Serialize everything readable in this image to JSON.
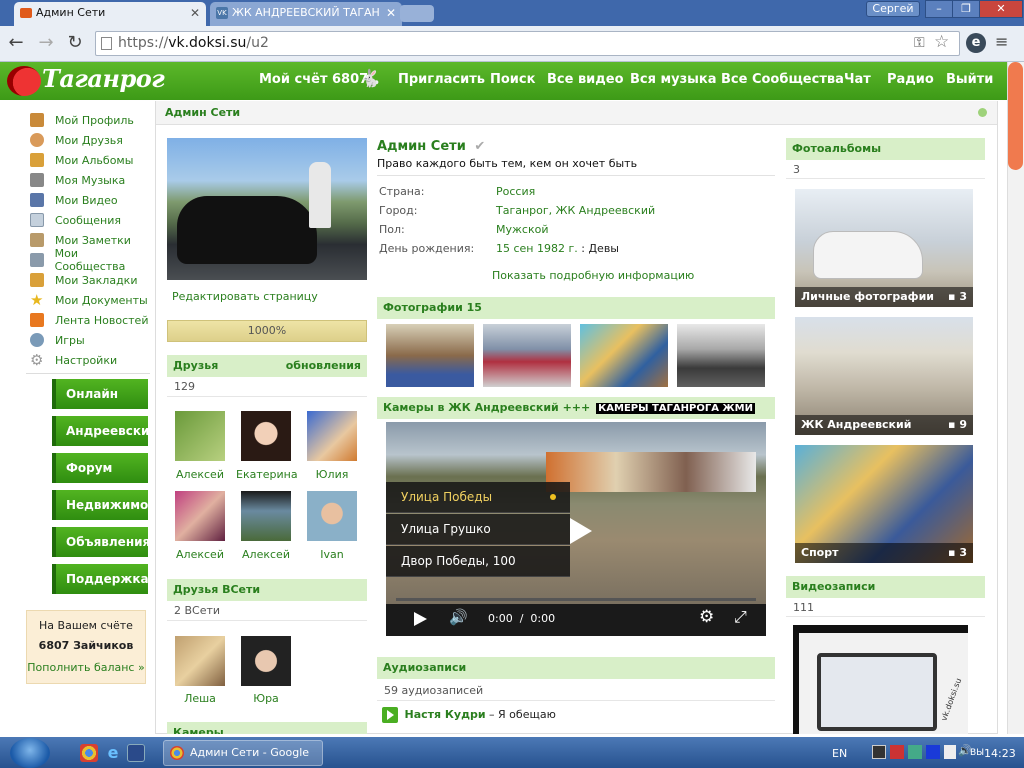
{
  "browser": {
    "tabs": [
      {
        "label": "Админ Сети"
      },
      {
        "label": "ЖК АНДРЕЕВСКИЙ ТАГАН"
      }
    ],
    "user_button": "Сергей",
    "win_min": "–",
    "win_max": "❐",
    "win_close": "✕",
    "url_scheme": "https://",
    "url_host": "vk.doksi.su",
    "url_path": "/u2"
  },
  "header": {
    "logo": "Таганрог",
    "nav": [
      {
        "label": "Мой счёт 6807"
      },
      {
        "label": "Пригласить"
      },
      {
        "label": "Поиск"
      },
      {
        "label": "Все видео"
      },
      {
        "label": "Вся музыка"
      },
      {
        "label": "Все Сообщества"
      },
      {
        "label": "Чат"
      },
      {
        "label": "Радио"
      },
      {
        "label": "Выйти"
      }
    ]
  },
  "sidebar": {
    "items": [
      {
        "label": "Мой Профиль",
        "icon": "house-icon",
        "color": "#c98a3a"
      },
      {
        "label": "Мои Друзья",
        "icon": "friends-icon",
        "color": "#d99a5a"
      },
      {
        "label": "Мои Альбомы",
        "icon": "album-icon",
        "color": "#d9a03a"
      },
      {
        "label": "Моя Музыка",
        "icon": "music-icon",
        "color": "#888888"
      },
      {
        "label": "Мои Видео",
        "icon": "video-icon",
        "color": "#5a76a8"
      },
      {
        "label": "Сообщения",
        "icon": "envelope-icon",
        "color": "#a8b8c8"
      },
      {
        "label": "Мои Заметки",
        "icon": "notes-icon",
        "color": "#b89a6a"
      },
      {
        "label": "Мои Сообщества",
        "icon": "community-icon",
        "color": "#8a9aaa"
      },
      {
        "label": "Мои Закладки",
        "icon": "bookmark-icon",
        "color": "#d9a03a"
      },
      {
        "label": "Мои Документы",
        "icon": "star-icon",
        "color": "#e8b820"
      },
      {
        "label": "Лента Новостей",
        "icon": "rss-icon",
        "color": "#e87820"
      },
      {
        "label": "Игры",
        "icon": "games-icon",
        "color": "#7a9ab8"
      },
      {
        "label": "Настройки",
        "icon": "gear-icon",
        "color": "#999999"
      }
    ],
    "buttons": [
      {
        "label": "Онлайн"
      },
      {
        "label": "Андреевский"
      },
      {
        "label": "Форум"
      },
      {
        "label": "Недвижимое"
      },
      {
        "label": "Объявления"
      },
      {
        "label": "Поддержка"
      }
    ],
    "balance": {
      "title": "На Вашем счёте",
      "amount": "6807 Зайчиков",
      "link": "Пополнить баланс »"
    }
  },
  "page": {
    "title": "Админ Сети"
  },
  "profile": {
    "name": "Админ Сети",
    "status": "Право каждого быть тем, кем он хочет быть",
    "edit_link": "Редактировать страницу",
    "progress_label": "1000%",
    "info": [
      {
        "label": "Страна:",
        "value": "Россия"
      },
      {
        "label": "Город:",
        "value": "Таганрог, ЖК Андреевский"
      },
      {
        "label": "Пол:",
        "value": "Мужской"
      },
      {
        "label": "День рождения:",
        "value": "15 сен 1982 г.",
        "suffix": " : Девы"
      }
    ],
    "more_link": "Показать подробную информацию"
  },
  "friends": {
    "title": "Друзья",
    "updates": "обновления",
    "count": "129",
    "list": [
      {
        "name": "Алексей"
      },
      {
        "name": "Екатерина"
      },
      {
        "name": "Юлия"
      },
      {
        "name": "Алексей"
      },
      {
        "name": "Алексей"
      },
      {
        "name": "Ivan"
      }
    ]
  },
  "online_friends": {
    "title": "Друзья ВСети",
    "count": "2 ВСети",
    "list": [
      {
        "name": "Леша"
      },
      {
        "name": "Юра"
      }
    ]
  },
  "cameras_left": {
    "title": "Камеры"
  },
  "photos": {
    "title": "Фотографии 15"
  },
  "cameras": {
    "title": "Камеры в ЖК Андреевский +++",
    "highlight": "КАМЕРЫ ТАГАНРОГА ЖМИ",
    "items": [
      {
        "label": "Улица Победы"
      },
      {
        "label": "Улица Грушко"
      },
      {
        "label": "Двор Победы, 100"
      }
    ],
    "time": "0:00  /  0:00"
  },
  "audio": {
    "title": "Аудиозаписи",
    "count": "59 аудиозаписей",
    "track_artist": "Настя Кудри",
    "track_title": " – Я обещаю"
  },
  "albums": {
    "title": "Фотоальбомы",
    "count": "3",
    "list": [
      {
        "name": "Личные фотографии",
        "count": "3"
      },
      {
        "name": "ЖК Андреевский",
        "count": "9"
      },
      {
        "name": "Спорт",
        "count": "3"
      }
    ]
  },
  "videos": {
    "title": "Видеозаписи",
    "count": "111",
    "thumb_caption": "vk.doksi.su"
  },
  "taskbar": {
    "task_label": "Админ Сети - Google ...",
    "lang": "EN",
    "lang_tray": "ВЫ",
    "time": "14:23"
  },
  "colors": {
    "brand_green": "#3d9a17",
    "link_green": "#2a7f1e",
    "section_bg": "#d8efc8"
  }
}
